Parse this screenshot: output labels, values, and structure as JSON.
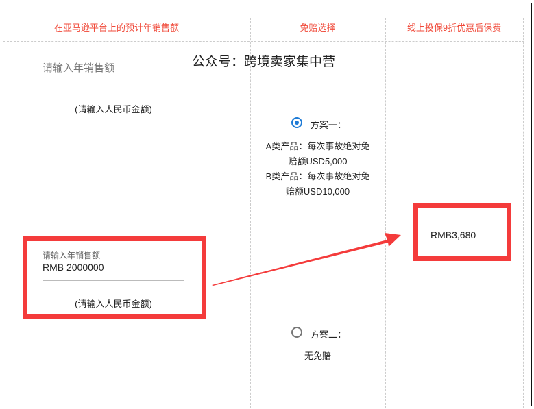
{
  "headers": {
    "sales": "在亚马逊平台上的预计年销售额",
    "deductible": "免赔选择",
    "premium": "线上投保9折优惠后保费"
  },
  "watermark": "公众号：跨境卖家集中营",
  "sales_input": {
    "placeholder": "请输入年销售额",
    "hint": "(请输入人民币金额)"
  },
  "sales_filled": {
    "label": "请输入年销售额",
    "value": "RMB 2000000",
    "hint": "(请输入人民币金额)"
  },
  "plans": [
    {
      "label": "方案一：",
      "selected": true,
      "lines": [
        "A类产品：每次事故绝对免",
        "赔额USD5,000",
        "B类产品：每次事故绝对免",
        "赔额USD10,000"
      ]
    },
    {
      "label": "方案二：",
      "selected": false,
      "lines": [
        "无免赔"
      ]
    }
  ],
  "premium_value": "RMB3,680",
  "colors": {
    "header": "#f04a3a",
    "highlight": "#f43b3b",
    "radio": "#1e7bd6"
  }
}
